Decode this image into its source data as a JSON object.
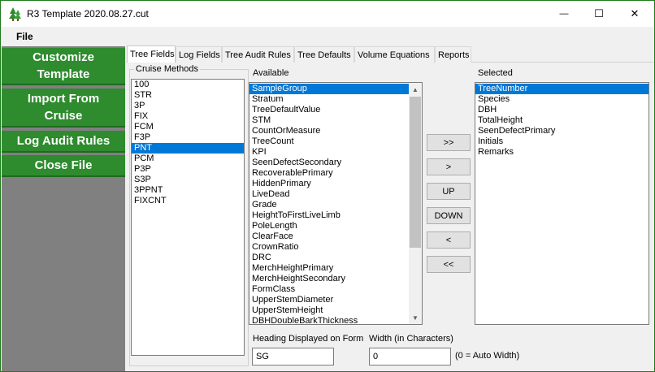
{
  "window": {
    "title": "R3 Template 2020.08.27.cut",
    "minimize_glyph": "—",
    "maximize_glyph": "☐",
    "close_glyph": "✕",
    "app_icon": "tree-icon"
  },
  "menu": {
    "file_label": "File"
  },
  "sidebar": {
    "customize_label": "Customize Template",
    "import_label": "Import From Cruise",
    "log_audit_label": "Log Audit Rules",
    "close_file_label": "Close File",
    "accent_color": "#2e8b2e"
  },
  "tabs": [
    {
      "label": "Tree Fields",
      "active": true
    },
    {
      "label": "Log Fields"
    },
    {
      "label": "Tree Audit Rules"
    },
    {
      "label": "Tree Defaults"
    },
    {
      "label": "Volume Equations"
    },
    {
      "label": "Reports"
    }
  ],
  "cruise_methods": {
    "label": "Cruise Methods",
    "items": [
      "100",
      "STR",
      "3P",
      "FIX",
      "FCM",
      "F3P",
      "PNT",
      "PCM",
      "P3P",
      "S3P",
      "3PPNT",
      "FIXCNT"
    ],
    "selected_index": 6
  },
  "available": {
    "label": "Available",
    "items": [
      "SampleGroup",
      "Stratum",
      "TreeDefaultValue",
      "STM",
      "CountOrMeasure",
      "TreeCount",
      "KPI",
      "SeenDefectSecondary",
      "RecoverablePrimary",
      "HiddenPrimary",
      "LiveDead",
      "Grade",
      "HeightToFirstLiveLimb",
      "PoleLength",
      "ClearFace",
      "CrownRatio",
      "DRC",
      "MerchHeightPrimary",
      "MerchHeightSecondary",
      "FormClass",
      "UpperStemDiameter",
      "UpperStemHeight",
      "DBHDoubleBarkThickness"
    ],
    "selected_index": 0
  },
  "selected": {
    "label": "Selected",
    "items": [
      "TreeNumber",
      "Species",
      "DBH",
      "TotalHeight",
      "SeenDefectPrimary",
      "Initials",
      "Remarks"
    ],
    "selected_index": 0
  },
  "buttons": {
    "add_all": ">>",
    "add_one": ">",
    "up": "UP",
    "down": "DOWN",
    "remove_one": "<",
    "remove_all": "<<"
  },
  "heading": {
    "label": "Heading Displayed on Form",
    "value": "SG"
  },
  "width": {
    "label": "Width (in Characters)",
    "value": "0",
    "hint": "(0 = Auto Width)"
  }
}
